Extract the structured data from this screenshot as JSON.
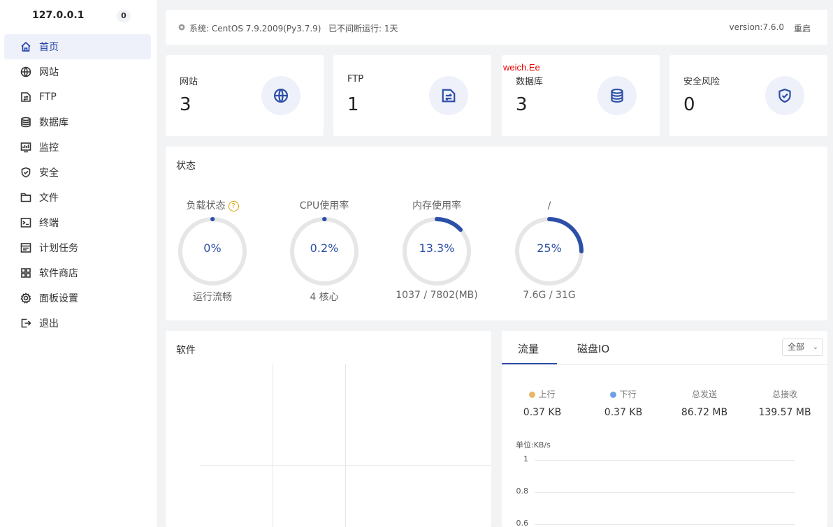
{
  "sidebar": {
    "host": "127.0.0.1",
    "badge": "0",
    "items": [
      {
        "label": "首页",
        "icon": "home-icon"
      },
      {
        "label": "网站",
        "icon": "globe-icon"
      },
      {
        "label": "FTP",
        "icon": "ftp-icon"
      },
      {
        "label": "数据库",
        "icon": "database-icon"
      },
      {
        "label": "监控",
        "icon": "monitor-icon"
      },
      {
        "label": "安全",
        "icon": "shield-icon"
      },
      {
        "label": "文件",
        "icon": "folder-icon"
      },
      {
        "label": "终端",
        "icon": "terminal-icon"
      },
      {
        "label": "计划任务",
        "icon": "task-icon"
      },
      {
        "label": "软件商店",
        "icon": "store-icon"
      },
      {
        "label": "面板设置",
        "icon": "gear-icon"
      },
      {
        "label": "退出",
        "icon": "logout-icon"
      }
    ]
  },
  "topbar": {
    "system": "系统:  CentOS 7.9.2009(Py3.7.9)",
    "uptime": "已不间断运行: 1天",
    "version": "version:7.6.0",
    "restart": "重启"
  },
  "cards": [
    {
      "label": "网站",
      "value": "3",
      "icon": "globe-icon"
    },
    {
      "label": "FTP",
      "value": "1",
      "icon": "ftp-icon"
    },
    {
      "label": "数据库",
      "value": "3",
      "icon": "database-icon"
    },
    {
      "label": "安全风险",
      "value": "0",
      "icon": "shield-check-icon"
    }
  ],
  "overlay_text": "weich.Ee",
  "status": {
    "title": "状态",
    "gauges": [
      {
        "title": "负载状态",
        "percent": "0%",
        "fraction": 0.0,
        "sub": "运行流畅",
        "help": "?"
      },
      {
        "title": "CPU使用率",
        "percent": "0.2%",
        "fraction": 0.002,
        "sub": "4 核心"
      },
      {
        "title": "内存使用率",
        "percent": "13.3%",
        "fraction": 0.133,
        "sub": "1037 / 7802(MB)"
      },
      {
        "title": "/",
        "percent": "25%",
        "fraction": 0.25,
        "sub": "7.6G / 31G"
      }
    ]
  },
  "software": {
    "title": "软件"
  },
  "traffic": {
    "tabs": [
      "流量",
      "磁盘IO"
    ],
    "select": "全部",
    "metrics": [
      {
        "label": "上行",
        "value": "0.37 KB",
        "color": "#e8b86a"
      },
      {
        "label": "下行",
        "value": "0.37 KB",
        "color": "#6ea0e8"
      },
      {
        "label": "总发送",
        "value": "86.72 MB"
      },
      {
        "label": "总接收",
        "value": "139.57 MB"
      }
    ],
    "unit": "单位:KB/s",
    "yticks": [
      "1",
      "0.8",
      "0.6"
    ]
  },
  "colors": {
    "accent": "#2c4fa7",
    "track": "#e6e6e6"
  }
}
